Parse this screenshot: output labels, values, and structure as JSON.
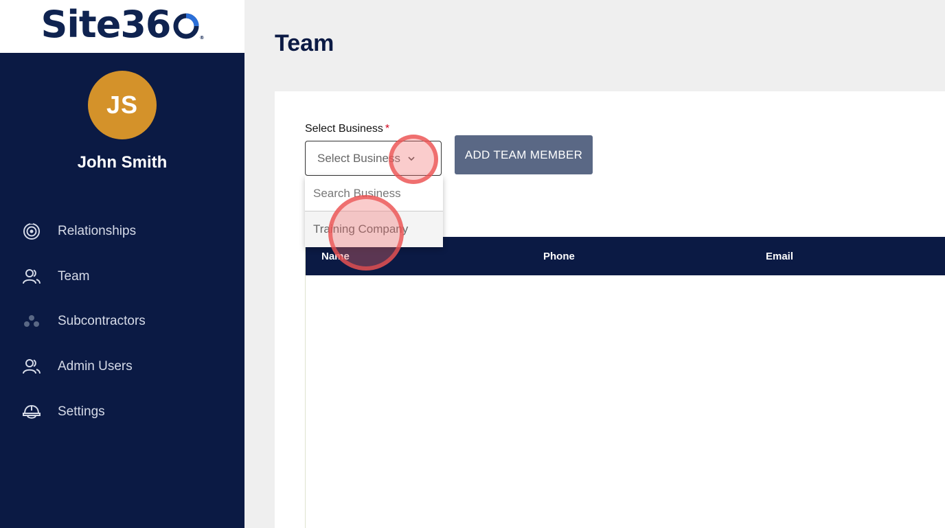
{
  "logo": {
    "text": "Site36",
    "reg": "®"
  },
  "user": {
    "initials": "JS",
    "name": "John Smith"
  },
  "nav": [
    {
      "label": "Relationships",
      "icon": "relationships-icon"
    },
    {
      "label": "Team",
      "icon": "users-icon"
    },
    {
      "label": "Subcontractors",
      "icon": "subcontractors-icon"
    },
    {
      "label": "Admin Users",
      "icon": "users-icon"
    },
    {
      "label": "Settings",
      "icon": "hardhat-icon"
    }
  ],
  "page": {
    "title": "Team"
  },
  "business_select": {
    "label": "Select Business",
    "required_mark": "*",
    "value": "Select Business",
    "search_placeholder": "Search Business",
    "options": [
      "Training Company"
    ]
  },
  "add_button": {
    "label": "ADD TEAM MEMBER"
  },
  "table": {
    "columns": [
      "Name",
      "Phone",
      "Email"
    ]
  },
  "colors": {
    "sidebar": "#0b1a44",
    "avatar": "#d4922a",
    "button": "#5a6885",
    "accent": "#2b6fd8"
  }
}
